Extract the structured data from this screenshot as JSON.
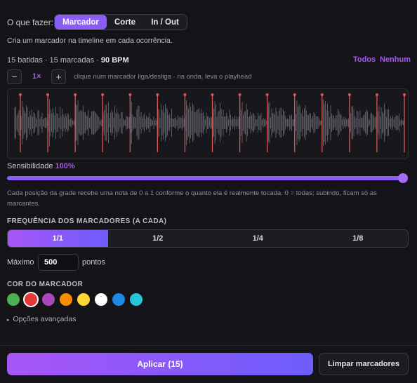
{
  "mode": {
    "label": "O que fazer:",
    "options": [
      "Marcador",
      "Corte",
      "In / Out"
    ],
    "selected": "Marcador"
  },
  "description": "Cria um marcador na timeline em cada ocorrência.",
  "stats": {
    "counts": "15 batidas · 15 marcadas · ",
    "bpm": "90 BPM"
  },
  "links": {
    "all": "Todos",
    "none": "Nenhum"
  },
  "zoom": {
    "minus": "−",
    "level": "1×",
    "plus": "+",
    "hint": "clique num marcador liga/desliga · na onda, leva o playhead"
  },
  "waveform": {
    "markers": 15,
    "marker_color": "#e05555",
    "wave_color": "#5a5a62"
  },
  "sensitivity": {
    "label": "Sensibilidade",
    "value": "100%",
    "fraction": 1.0,
    "description": "Cada posição da grade recebe uma nota de 0 a 1 conforme o quanto ela é realmente tocada. 0 = todas; subindo, ficam só as marcantes."
  },
  "frequency": {
    "title": "FREQUÊNCIA DOS MARCADORES (A CADA)",
    "options": [
      "1/1",
      "1/2",
      "1/4",
      "1/8"
    ],
    "selected": "1/1"
  },
  "maximum": {
    "label": "Máximo",
    "value": "500",
    "unit": "pontos"
  },
  "color": {
    "title": "COR DO MARCADOR",
    "swatches": [
      "#4caf50",
      "#e53935",
      "#ab47bc",
      "#fb8c00",
      "#fdd835",
      "#ffffff",
      "#1e88e5",
      "#26c6da"
    ],
    "selected_index": 1
  },
  "advanced": {
    "caret": "▸",
    "label": "Opções avançadas"
  },
  "actions": {
    "apply": "Aplicar (15)",
    "clear": "Limpar marcadores"
  }
}
